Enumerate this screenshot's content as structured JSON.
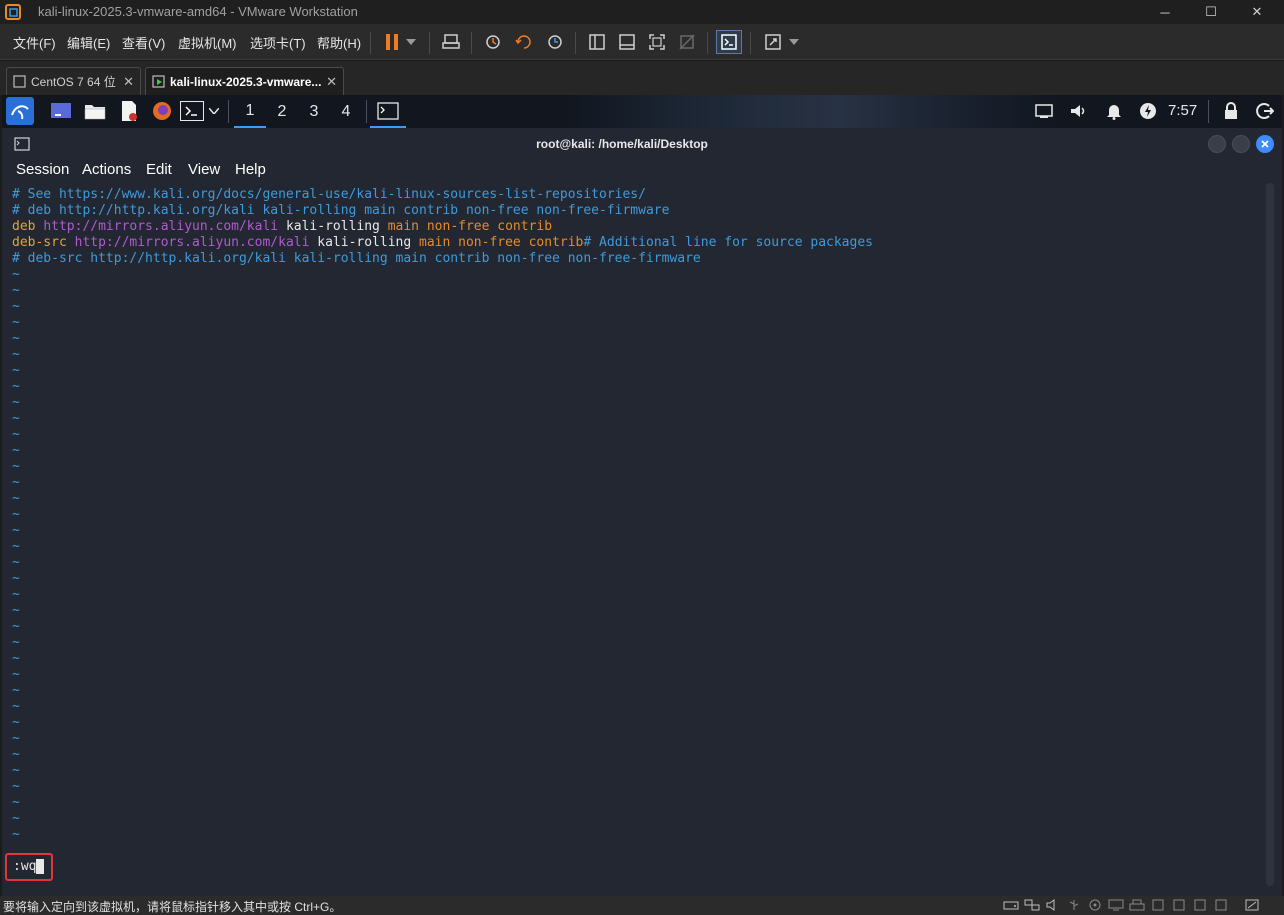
{
  "window": {
    "title": "kali-linux-2025.3-vmware-amd64 - VMware Workstation",
    "minimize": "─",
    "maximize": "☐",
    "close": "✕"
  },
  "menu": [
    "文件(F)",
    "编辑(E)",
    "查看(V)",
    "虚拟机(M)",
    "选项卡(T)",
    "帮助(H)"
  ],
  "tabs": [
    {
      "label": "CentOS 7 64 位",
      "close": "✕"
    },
    {
      "label": "kali-linux-2025.3-vmware...",
      "close": "✕"
    }
  ],
  "kali_panel": {
    "workspaces": [
      "1",
      "2",
      "3",
      "4"
    ],
    "clock": "7:57"
  },
  "terminal": {
    "title": "root@kali: /home/kali/Desktop",
    "menu": [
      "Session",
      "Actions",
      "Edit",
      "View",
      "Help"
    ],
    "lines": [
      [
        {
          "t": "# See https://www.kali.org/docs/general-use/kali-linux-sources-list-repositories/",
          "c": "c-comment"
        }
      ],
      [
        {
          "t": "# deb http://http.kali.org/kali kali-rolling main contrib non-free non-free-firmware",
          "c": "c-comment"
        }
      ],
      [
        {
          "t": "deb ",
          "c": "c-kw"
        },
        {
          "t": "http://mirrors.aliyun.com/kali",
          "c": "c-url"
        },
        {
          "t": " kali-rolling ",
          "c": "c-white"
        },
        {
          "t": "main non-free contrib",
          "c": "c-orange"
        }
      ],
      [
        {
          "t": "deb-src ",
          "c": "c-kw"
        },
        {
          "t": "http://mirrors.aliyun.com/kali",
          "c": "c-url"
        },
        {
          "t": " kali-rolling ",
          "c": "c-white"
        },
        {
          "t": "main non-free contrib",
          "c": "c-orange"
        },
        {
          "t": "# Additional line for source packages",
          "c": "c-comment"
        }
      ],
      [
        {
          "t": "# deb-src http://http.kali.org/kali kali-rolling main contrib non-free non-free-firmware",
          "c": "c-comment"
        }
      ]
    ],
    "tilde": "~",
    "tilde_count": 36,
    "command": ":wq"
  },
  "statusbar": {
    "message": "要将输入定向到该虚拟机，请将鼠标指针移入其中或按 Ctrl+G。"
  },
  "colors": {
    "accent": "#3d9bff",
    "pause": "#f07b24",
    "highlight_box": "#e0363c"
  }
}
